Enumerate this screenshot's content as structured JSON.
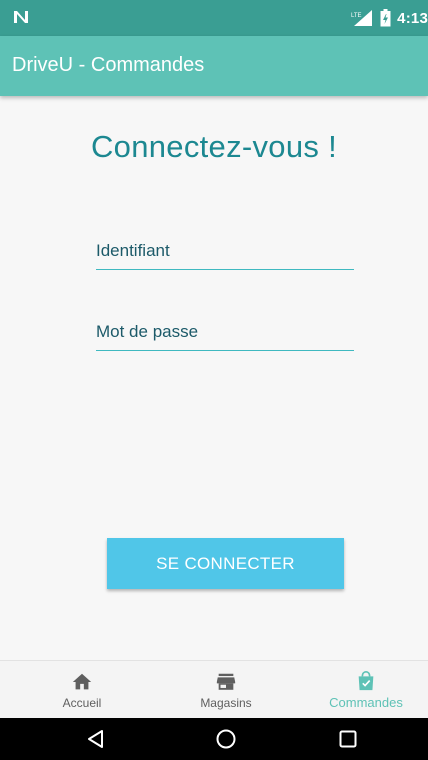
{
  "status_bar": {
    "time": "4:13",
    "icons": [
      "notification-n-icon",
      "lte-signal-icon",
      "battery-icon"
    ]
  },
  "app_bar": {
    "title": "DriveU - Commandes"
  },
  "login": {
    "heading": "Connectez-vous !",
    "username_placeholder": "Identifiant",
    "password_placeholder": "Mot de passe",
    "submit_label": "SE CONNECTER"
  },
  "bottom_nav": {
    "items": [
      {
        "label": "Accueil",
        "icon": "home-icon",
        "active": false
      },
      {
        "label": "Magasins",
        "icon": "store-icon",
        "active": false
      },
      {
        "label": "Commandes",
        "icon": "shopping-bag-icon",
        "active": true
      }
    ]
  },
  "colors": {
    "status_bar": "#3a9e93",
    "app_bar": "#5ec2b6",
    "heading": "#1c8891",
    "underline": "#3fb9c0",
    "button": "#50c6e8",
    "nav_active": "#5ec2b6"
  }
}
